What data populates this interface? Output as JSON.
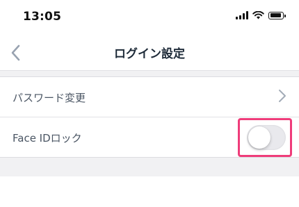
{
  "status_bar": {
    "time": "13:05"
  },
  "nav": {
    "title": "ログイン設定",
    "back_icon": "chevron-left-icon"
  },
  "settings": {
    "items": [
      {
        "label": "パスワード変更",
        "accessory": "chevron-right-icon"
      },
      {
        "label": "Face IDロック",
        "accessory": "toggle"
      }
    ]
  },
  "face_id_lock": {
    "enabled": false
  },
  "colors": {
    "highlight": "#ef3c7a",
    "separator": "#e1e1e5",
    "group_background": "#f1f1f3",
    "accent_gray": "#98a2b0"
  }
}
